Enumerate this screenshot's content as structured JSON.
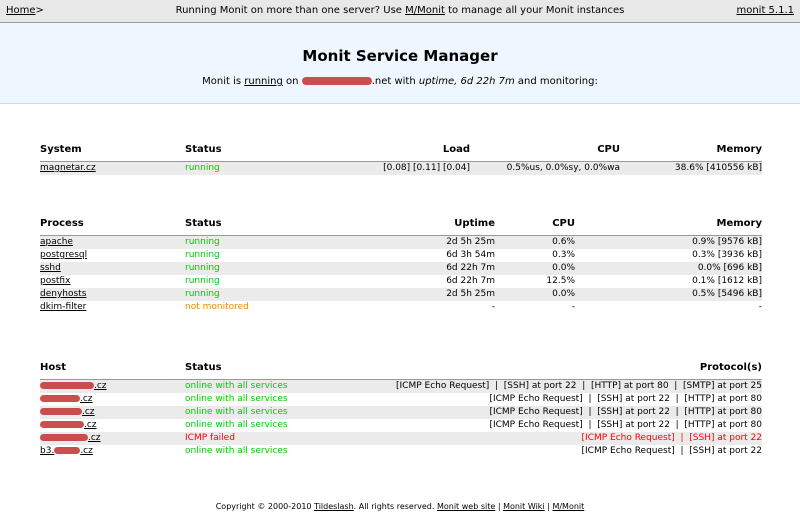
{
  "topbar": {
    "home_label": "Home",
    "home_sep": ">",
    "promo_prefix": "Running Monit on more than one server? Use ",
    "promo_link": "M/Monit",
    "promo_suffix": " to manage all your Monit instances",
    "version_link": "monit 5.1.1"
  },
  "header": {
    "title": "Monit Service Manager",
    "sub_prefix": "Monit is ",
    "running_link": "running",
    "sub_on": " on ",
    "host_suffix": ".net with ",
    "uptime_label": "uptime, 6d 22h 7m",
    "sub_end": "  and monitoring:"
  },
  "system_table": {
    "headers": [
      "System",
      "Status",
      "Load",
      "CPU",
      "Memory"
    ],
    "rows": [
      {
        "name": "magnetar.cz",
        "status": "running",
        "load": "[0.08] [0.11] [0.04]",
        "cpu": "0.5%us, 0.0%sy, 0.0%wa",
        "memory": "38.6% [410556 kB]"
      }
    ]
  },
  "process_table": {
    "headers": [
      "Process",
      "Status",
      "Uptime",
      "CPU",
      "Memory"
    ],
    "rows": [
      {
        "name": "apache",
        "status": "running",
        "uptime": "2d 5h 25m",
        "cpu": "0.6%",
        "memory": "0.9% [9576 kB]"
      },
      {
        "name": "postgresql",
        "status": "running",
        "uptime": "6d 3h 54m",
        "cpu": "0.3%",
        "memory": "0.3% [3936 kB]"
      },
      {
        "name": "sshd",
        "status": "running",
        "uptime": "6d 22h 7m",
        "cpu": "0.0%",
        "memory": "0.0% [696 kB]"
      },
      {
        "name": "postfix",
        "status": "running",
        "uptime": "6d 22h 7m",
        "cpu": "12.5%",
        "memory": "0.1% [1612 kB]"
      },
      {
        "name": "denyhosts",
        "status": "running",
        "uptime": "2d 5h 25m",
        "cpu": "0.0%",
        "memory": "0.5% [5496 kB]"
      },
      {
        "name": "dkim-filter",
        "status": "not monitored",
        "uptime": "-",
        "cpu": "-",
        "memory": "-"
      }
    ]
  },
  "host_table": {
    "headers": [
      "Host",
      "Status",
      "Protocol(s)"
    ],
    "rows": [
      {
        "prefix": "",
        "suffix": ".cz",
        "status": "online with all services",
        "protocols": "[ICMP Echo Request]  |  [SSH] at port 22  |  [HTTP] at port 80  |  [SMTP] at port 25"
      },
      {
        "prefix": "",
        "suffix": ".cz",
        "status": "online with all services",
        "protocols": "[ICMP Echo Request]  |  [SSH] at port 22  |  [HTTP] at port 80"
      },
      {
        "prefix": "",
        "suffix": ".cz",
        "status": "online with all services",
        "protocols": "[ICMP Echo Request]  |  [SSH] at port 22  |  [HTTP] at port 80"
      },
      {
        "prefix": "",
        "suffix": ".cz",
        "status": "online with all services",
        "protocols": "[ICMP Echo Request]  |  [SSH] at port 22  |  [HTTP] at port 80"
      },
      {
        "prefix": "",
        "suffix": ".cz",
        "status": "ICMP failed",
        "protocols": "[ICMP Echo Request]  |  [SSH] at port 22"
      },
      {
        "prefix": "b3.",
        "suffix": ".cz",
        "status": "online with all services",
        "protocols": "[ICMP Echo Request]  |  [SSH] at port 22"
      }
    ]
  },
  "footer": {
    "copyright": "Copyright © 2000-2010 ",
    "company_link": "Tildeslash",
    "rights": ". All rights reserved.  ",
    "links": [
      "Monit web site",
      "Monit Wiki",
      "M/Monit"
    ],
    "sep": " | "
  },
  "colors": {
    "running": "#00cc00",
    "not_monitored": "#ee8800",
    "failed": "#ff0000"
  }
}
